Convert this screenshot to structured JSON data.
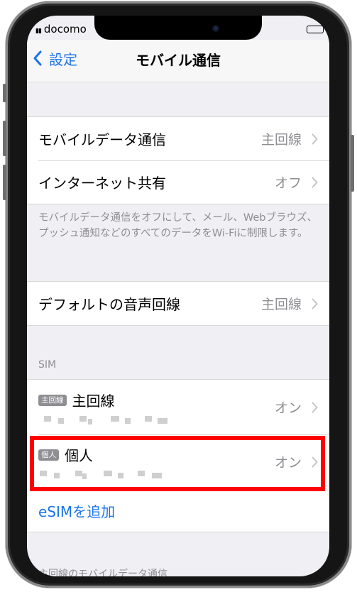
{
  "status_bar": {
    "carrier": "docomo"
  },
  "nav": {
    "back_label": "設定",
    "title": "モバイル通信"
  },
  "data_group": [
    {
      "label": "モバイルデータ通信",
      "value": "主回線"
    },
    {
      "label": "インターネット共有",
      "value": "オフ"
    }
  ],
  "data_footer": "モバイルデータ通信をオフにして、メール、Webブラウズ、プッシュ通知などのすべてのデータをWi-Fiに制限します。",
  "voice_row": {
    "label": "デフォルトの音声回線",
    "value": "主回線"
  },
  "sim_section": {
    "header": "SIM",
    "lines": [
      {
        "badge": "主回線",
        "name": "主回線",
        "status": "オン"
      },
      {
        "badge": "個人",
        "name": "個人",
        "status": "オン"
      }
    ],
    "add_esim": "eSIMを追加"
  },
  "next_section_header": "主回線のモバイルデータ通信",
  "colors": {
    "accent": "#1a73e8",
    "highlight": "#ff0000"
  }
}
